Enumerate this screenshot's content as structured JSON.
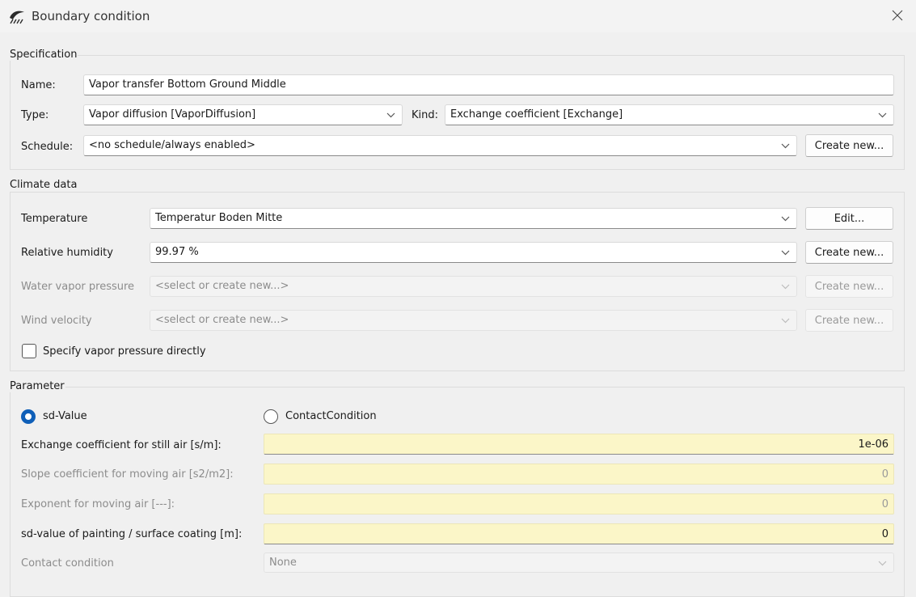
{
  "window": {
    "title": "Boundary condition"
  },
  "specification": {
    "group_label": "Specification",
    "name_label": "Name:",
    "name_value": "Vapor transfer Bottom Ground Middle",
    "type_label": "Type:",
    "type_value": "Vapor diffusion [VaporDiffusion]",
    "kind_label": "Kind:",
    "kind_value": "Exchange coefficient [Exchange]",
    "schedule_label": "Schedule:",
    "schedule_value": "<no schedule/always enabled>",
    "schedule_button": "Create new..."
  },
  "climate": {
    "group_label": "Climate data",
    "temperature_label": "Temperature",
    "temperature_value": "Temperatur Boden Mitte",
    "temperature_button": "Edit...",
    "humidity_label": "Relative humidity",
    "humidity_value": "99.97 %",
    "humidity_button": "Create new...",
    "vapor_pressure_label": "Water vapor pressure",
    "vapor_pressure_value": "<select or create new...>",
    "vapor_pressure_button": "Create new...",
    "wind_label": "Wind velocity",
    "wind_value": "<select or create new...>",
    "wind_button": "Create new...",
    "checkbox_label": "Specify vapor pressure directly",
    "checkbox_checked": false
  },
  "parameter": {
    "group_label": "Parameter",
    "radio_sd_label": "sd-Value",
    "radio_contact_label": "ContactCondition",
    "selected": "sd-Value",
    "still_air_label": "Exchange coefficient for still air [s/m]:",
    "still_air_value": "1e-06",
    "slope_label": "Slope coefficient for moving air [s2/m2]:",
    "slope_value": "0",
    "exponent_label": "Exponent for moving air [---]:",
    "exponent_value": "0",
    "sd_coating_label": "sd-value of painting / surface coating [m]:",
    "sd_coating_value": "0",
    "contact_label": "Contact condition",
    "contact_value": "None"
  },
  "colors": {
    "accent": "#0f5fb8",
    "input_highlight": "#fbf6c8"
  }
}
